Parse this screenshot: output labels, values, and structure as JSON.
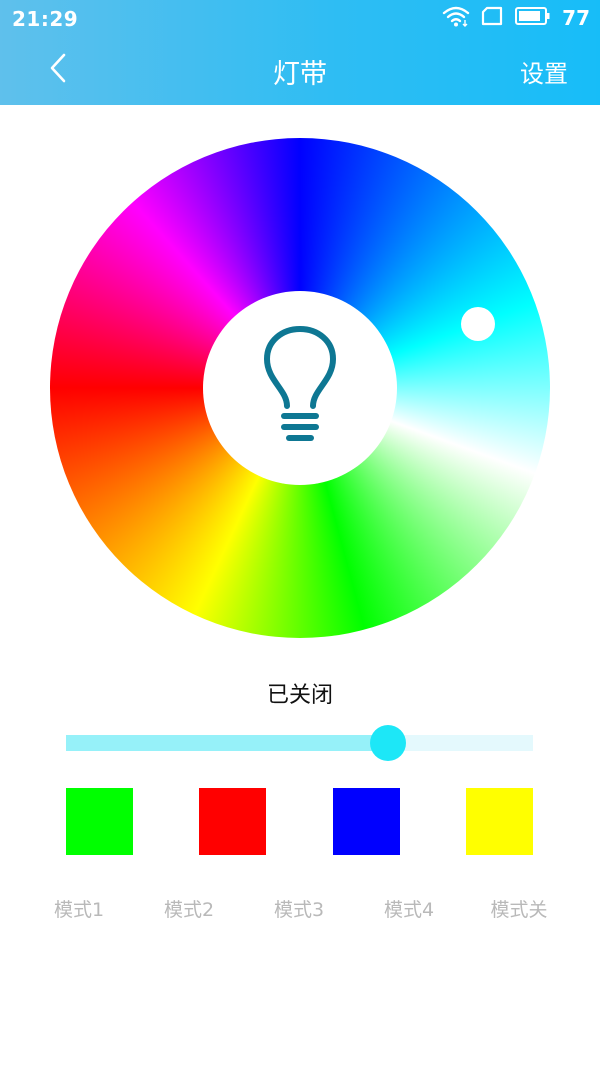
{
  "status_bar": {
    "time": "21:29",
    "battery": "77",
    "icons": [
      "wifi-icon",
      "sim-icon",
      "battery-icon"
    ]
  },
  "nav": {
    "title": "灯带",
    "back_icon": "chevron-left-icon",
    "settings_label": "设置"
  },
  "color_wheel": {
    "center_icon": "lightbulb-icon",
    "selected_color": "#00ffff"
  },
  "state_label": "已关闭",
  "brightness": {
    "value_percent": 69
  },
  "swatches": [
    {
      "color": "#00ff00"
    },
    {
      "color": "#ff0000"
    },
    {
      "color": "#0000ff"
    },
    {
      "color": "#ffff00"
    }
  ],
  "modes": [
    "模式1",
    "模式2",
    "模式3",
    "模式4",
    "模式关"
  ]
}
